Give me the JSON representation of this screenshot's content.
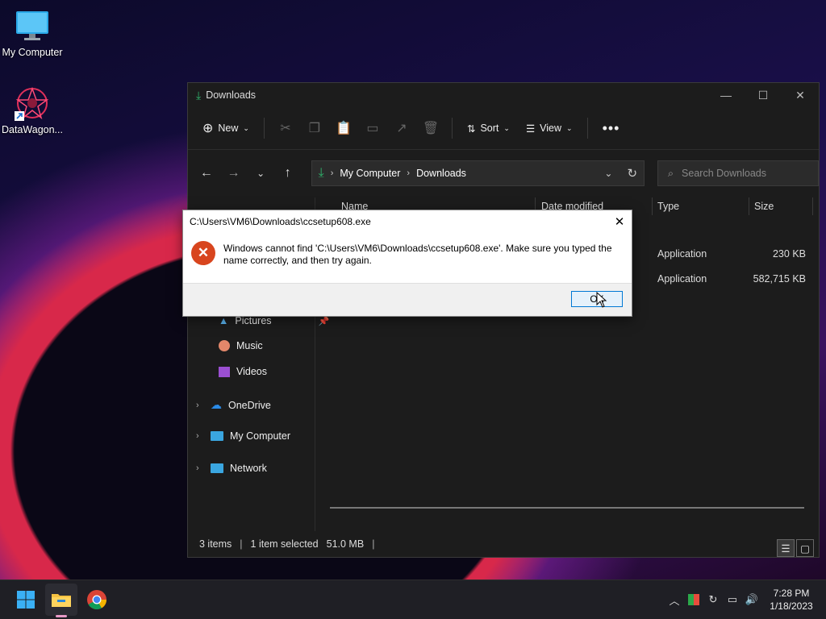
{
  "desktop": {
    "icons": [
      {
        "label": "My Computer"
      },
      {
        "label": "DataWagon..."
      }
    ]
  },
  "explorer": {
    "title": "Downloads",
    "toolbar": {
      "new_label": "New",
      "sort_label": "Sort",
      "view_label": "View"
    },
    "address": {
      "crumbs": [
        "My Computer",
        "Downloads"
      ]
    },
    "search": {
      "placeholder": "Search Downloads"
    },
    "columns": {
      "name": "Name",
      "date": "Date modified",
      "type": "Type",
      "size": "Size"
    },
    "rows": [
      {
        "type": "Application",
        "size": "230 KB"
      },
      {
        "type": "Application",
        "size": "582,715 KB"
      }
    ],
    "sidebar": {
      "pictures": "Pictures",
      "music": "Music",
      "videos": "Videos",
      "onedrive": "OneDrive",
      "mycomputer": "My Computer",
      "network": "Network"
    },
    "status": {
      "items": "3 items",
      "selected": "1 item selected",
      "size": "51.0 MB"
    }
  },
  "dialog": {
    "title": "C:\\Users\\VM6\\Downloads\\ccsetup608.exe",
    "message": "Windows cannot find 'C:\\Users\\VM6\\Downloads\\ccsetup608.exe'. Make sure you typed the name correctly, and then try again.",
    "ok_label": "OK"
  },
  "taskbar": {
    "time": "7:28 PM",
    "date": "1/18/2023"
  },
  "colors": {
    "accent": "#0078d4",
    "error": "#d8451e",
    "folder": "#f5c242"
  }
}
